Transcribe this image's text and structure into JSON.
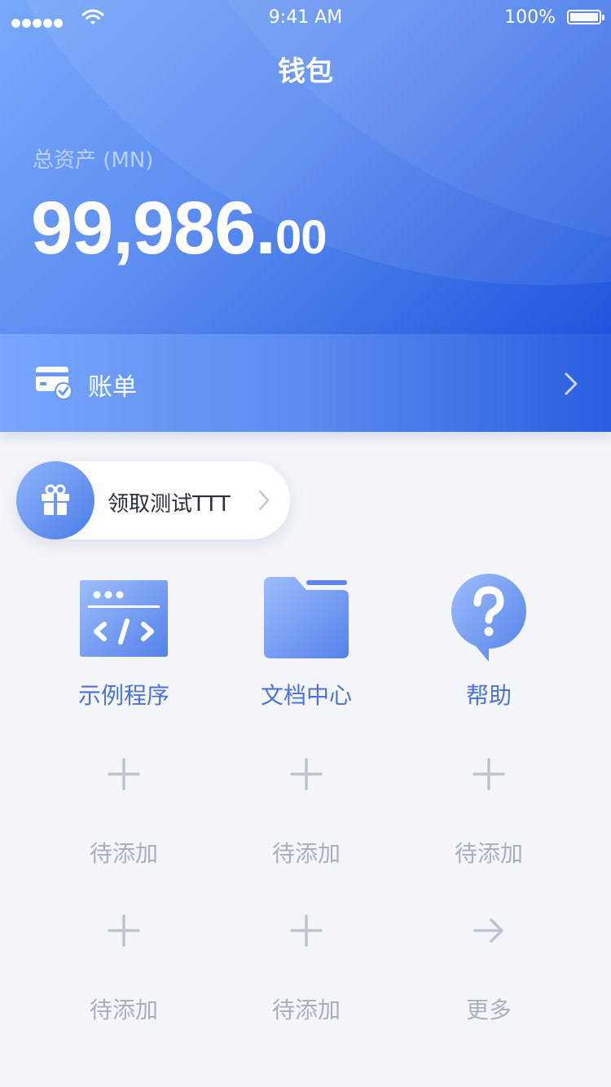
{
  "status_bar": {
    "time": "9:41 AM",
    "battery": "100%"
  },
  "header": {
    "title": "钱包"
  },
  "assets": {
    "label": "总资产 (MN)",
    "amount_int": "99,986.",
    "amount_dec": "00"
  },
  "bill": {
    "label": "账单"
  },
  "promo": {
    "label": "领取测试TTT"
  },
  "grid": {
    "row1": [
      {
        "label": "示例程序",
        "icon": "code-window-icon"
      },
      {
        "label": "文档中心",
        "icon": "folder-icon"
      },
      {
        "label": "帮助",
        "icon": "help-bubble-icon"
      }
    ],
    "row2": [
      {
        "label": "待添加",
        "icon": "plus-icon"
      },
      {
        "label": "待添加",
        "icon": "plus-icon"
      },
      {
        "label": "待添加",
        "icon": "plus-icon"
      }
    ],
    "row3": [
      {
        "label": "待添加",
        "icon": "plus-icon"
      },
      {
        "label": "待添加",
        "icon": "plus-icon"
      },
      {
        "label": "更多",
        "icon": "arrow-right-icon"
      }
    ]
  },
  "colors": {
    "brand_blue": "#4c74d8",
    "hero_start": "#78a9fb",
    "hero_end": "#1f55dc",
    "pending_gray": "#a9b0bd"
  }
}
